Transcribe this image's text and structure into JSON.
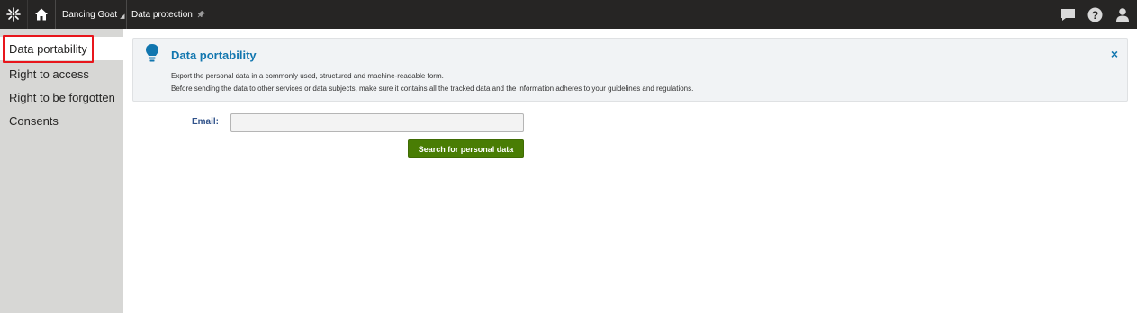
{
  "topbar": {
    "logo_icon": "kentico-logo-icon",
    "home_icon": "home-icon",
    "site_name": "Dancing Goat",
    "site_caret": "◢",
    "app_name": "Data protection",
    "pin_icon": "pin-icon",
    "right_icons": [
      "chat-icon",
      "help-icon",
      "user-icon"
    ]
  },
  "sidebar": {
    "items": [
      {
        "label": "Data portability",
        "active": true
      },
      {
        "label": "Right to access"
      },
      {
        "label": "Right to be forgotten"
      },
      {
        "label": "Consents"
      }
    ]
  },
  "info": {
    "icon": "lightbulb-icon",
    "title": "Data portability",
    "line1": "Export the personal data in a commonly used, structured and machine-readable form.",
    "line2": "Before sending the data to other services or data subjects, make sure it contains all the tracked data and the information adheres to your guidelines and regulations.",
    "close": "×"
  },
  "form": {
    "email_label": "Email:",
    "email_value": "",
    "search_button": "Search for personal data"
  },
  "colors": {
    "topbar": "#262524",
    "sidebar": "#d7d7d5",
    "accent": "#1176af",
    "button": "#497d04",
    "highlight": "#e8161c"
  }
}
